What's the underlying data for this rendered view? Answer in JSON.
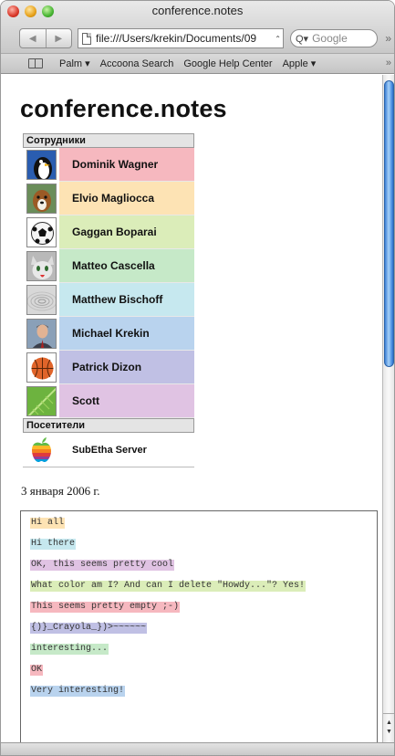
{
  "window": {
    "title": "conference.notes"
  },
  "toolbar": {
    "back_symbol": "◀",
    "forward_symbol": "▶",
    "url": "file:///Users/krekin/Documents/09",
    "url_arrows": "⌃",
    "search_placeholder": "Google",
    "more": "»"
  },
  "bookmarks": {
    "items": [
      "Palm ▾",
      "Accoona Search",
      "Google Help Center",
      "Apple ▾"
    ],
    "more": "»"
  },
  "page": {
    "title": "conference.notes",
    "employees_header": "Сотрудники",
    "employees": [
      {
        "name": "Dominik Wagner",
        "color": "#f6b8bf",
        "avatar": "penguin"
      },
      {
        "name": "Elvio Magliocca",
        "color": "#fde3b4",
        "avatar": "dog"
      },
      {
        "name": "Gaggan Boparai",
        "color": "#dbedb9",
        "avatar": "soccer-ball"
      },
      {
        "name": "Matteo Cascella",
        "color": "#c6e9c8",
        "avatar": "cat"
      },
      {
        "name": "Matthew Bischoff",
        "color": "#c6e8ef",
        "avatar": "ripple"
      },
      {
        "name": "Michael Krekin",
        "color": "#b9d3ee",
        "avatar": "man-portrait"
      },
      {
        "name": "Patrick Dizon",
        "color": "#c0c0e4",
        "avatar": "basketball"
      },
      {
        "name": "Scott",
        "color": "#e0c3e3",
        "avatar": "leaf"
      }
    ],
    "visitors_header": "Посетители",
    "visitors": [
      {
        "name": "SubEtha Server",
        "avatar": "apple-logo"
      }
    ],
    "date": "3 января 2006 г.",
    "messages": [
      {
        "text": "Hi all",
        "color": "#fde3b4"
      },
      {
        "text": "Hi there",
        "color": "#c6e8ef"
      },
      {
        "text": "OK, this seems pretty cool",
        "color": "#e0c3e3"
      },
      {
        "text": "What color am I? And can I delete \"Howdy...\"? Yes!",
        "color": "#dbedb9"
      },
      {
        "text": "This seems pretty empty ;-)",
        "color": "#f6b8bf"
      },
      {
        "text": "{)}_Crayola_})>~~~~~~",
        "color": "#c0c0e4"
      },
      {
        "text": "interesting...",
        "color": "#c6e9c8"
      },
      {
        "text": "OK",
        "color": "#f6b8bf"
      },
      {
        "text": "Very interesting!",
        "color": "#b9d3ee"
      }
    ]
  }
}
